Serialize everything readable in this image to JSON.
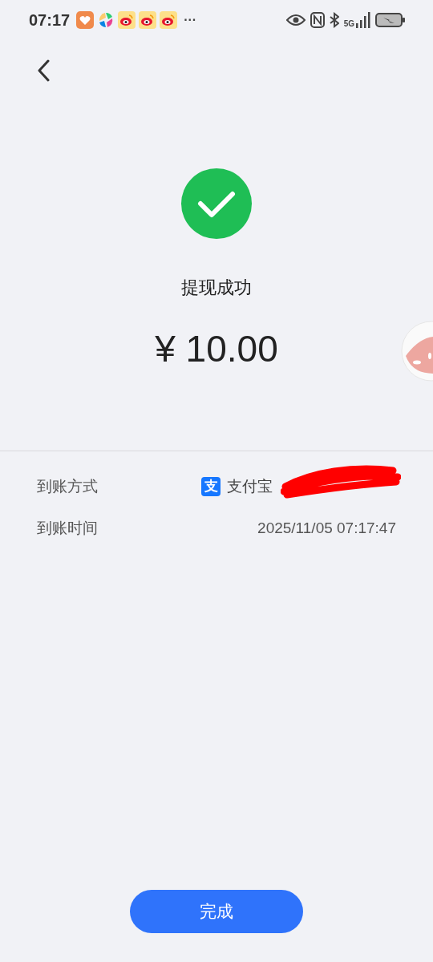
{
  "status_bar": {
    "time": "07:17",
    "more": "···",
    "network": "5G"
  },
  "result": {
    "title": "提现成功",
    "amount": "¥ 10.00"
  },
  "details": [
    {
      "kind": "method",
      "label": "到账方式",
      "icon_glyph": "支",
      "value": "支付宝"
    },
    {
      "kind": "time",
      "label": "到账时间",
      "value": "2025/11/05 07:17:47"
    }
  ],
  "done_button": "完成"
}
